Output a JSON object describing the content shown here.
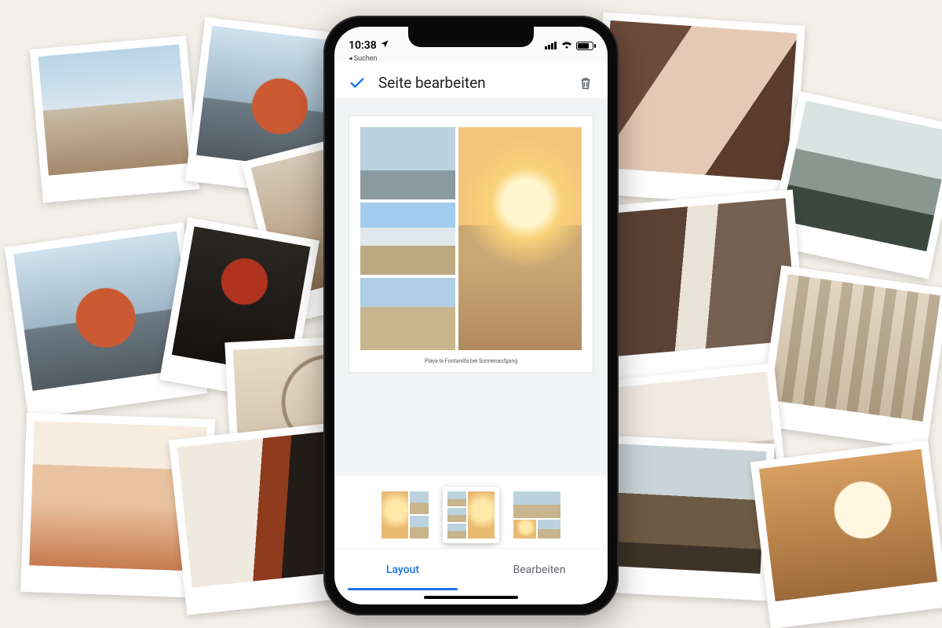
{
  "statusbar": {
    "time": "10:38",
    "back_to_app": "Suchen"
  },
  "header": {
    "title": "Seite bearbeiten"
  },
  "page": {
    "caption": "Playa la Fontanilla bei Sonnenaufgang"
  },
  "tabs": {
    "layout": "Layout",
    "edit": "Bearbeiten"
  },
  "colors": {
    "accent": "#1a73e8"
  }
}
